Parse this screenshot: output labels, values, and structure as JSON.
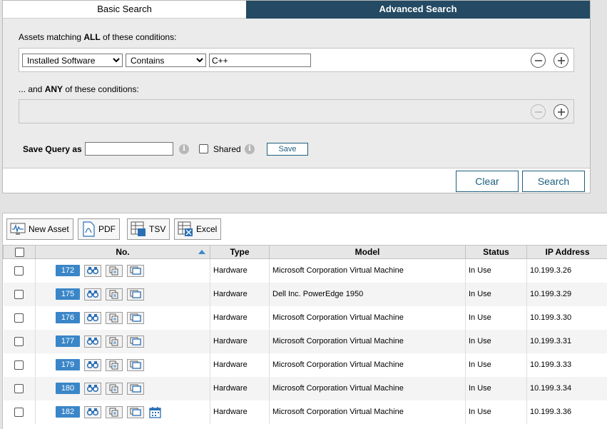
{
  "tabs": {
    "basic": "Basic Search",
    "advanced": "Advanced Search"
  },
  "all_conditions": {
    "label_prefix": "Assets matching ",
    "label_bold": "ALL",
    "label_suffix": " of these conditions:",
    "field": "Installed Software",
    "operator": "Contains",
    "value": "C++"
  },
  "any_conditions": {
    "label_prefix": "... and ",
    "label_bold": "ANY",
    "label_suffix": " of these conditions:"
  },
  "save_query": {
    "label": "Save Query as",
    "value": "",
    "shared_label": "Shared",
    "save_button": "Save"
  },
  "actions": {
    "clear": "Clear",
    "search": "Search"
  },
  "toolbar": {
    "new_asset": "New Asset",
    "pdf": "PDF",
    "tsv": "TSV",
    "excel": "Excel"
  },
  "columns": [
    "No.",
    "Type",
    "Model",
    "Status",
    "IP Address"
  ],
  "rows": [
    {
      "no": "172",
      "type": "Hardware",
      "model": "Microsoft Corporation Virtual Machine",
      "status": "In Use",
      "ip": "10.199.3.26",
      "calendar": false
    },
    {
      "no": "175",
      "type": "Hardware",
      "model": "Dell Inc. PowerEdge 1950",
      "status": "In Use",
      "ip": "10.199.3.29",
      "calendar": false
    },
    {
      "no": "176",
      "type": "Hardware",
      "model": "Microsoft Corporation Virtual Machine",
      "status": "In Use",
      "ip": "10.199.3.30",
      "calendar": false
    },
    {
      "no": "177",
      "type": "Hardware",
      "model": "Microsoft Corporation Virtual Machine",
      "status": "In Use",
      "ip": "10.199.3.31",
      "calendar": false
    },
    {
      "no": "179",
      "type": "Hardware",
      "model": "Microsoft Corporation Virtual Machine",
      "status": "In Use",
      "ip": "10.199.3.33",
      "calendar": false
    },
    {
      "no": "180",
      "type": "Hardware",
      "model": "Microsoft Corporation Virtual Machine",
      "status": "In Use",
      "ip": "10.199.3.34",
      "calendar": false
    },
    {
      "no": "182",
      "type": "Hardware",
      "model": "Microsoft Corporation Virtual Machine",
      "status": "In Use",
      "ip": "10.199.3.36",
      "calendar": true
    }
  ],
  "colors": {
    "tab_active": "#244a64",
    "accent": "#1c5f7e",
    "badge": "#3a86c8"
  },
  "icons": [
    "minus-circle-icon",
    "plus-circle-icon",
    "info-icon",
    "monitor-pulse-icon",
    "pdf-icon",
    "tsv-icon",
    "excel-icon",
    "binoculars-icon",
    "copy-icon",
    "windows-icon",
    "calendar-icon"
  ]
}
